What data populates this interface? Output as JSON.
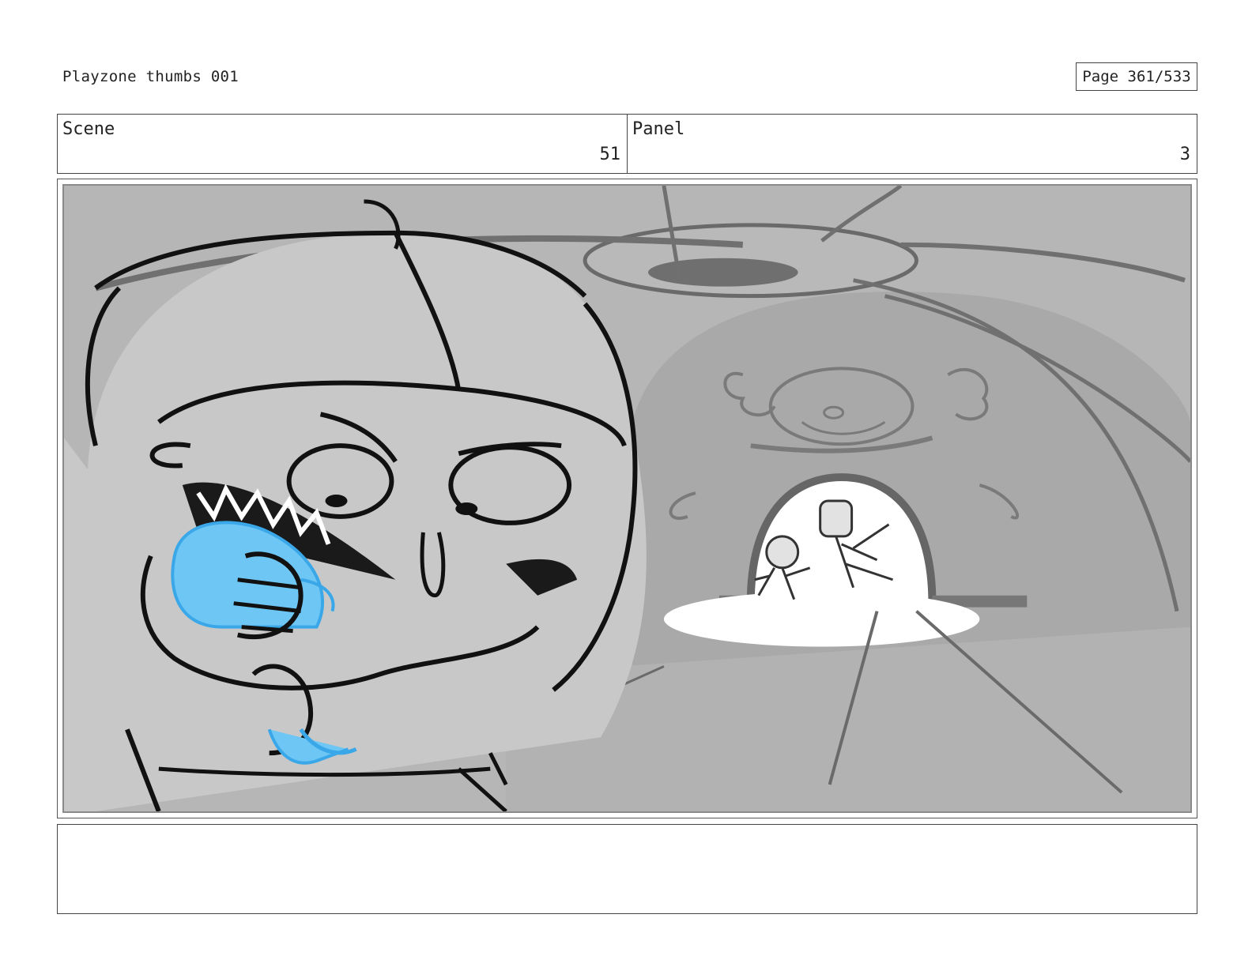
{
  "header": {
    "title": "Playzone thumbs 001",
    "page": "Page 361/533"
  },
  "scene": {
    "label": "Scene",
    "value": "51"
  },
  "panel": {
    "label": "Panel",
    "value": "3"
  },
  "illustration": {
    "description_colors": {
      "sky_gray": "#b4b4b4",
      "wall_gray": "#a6a6a6",
      "floor_gray": "#b0b0b0",
      "light_white": "#ffffff",
      "highlight_blue": "#6ec6f5",
      "ink": "#111111"
    }
  },
  "notes": {
    "text": ""
  }
}
